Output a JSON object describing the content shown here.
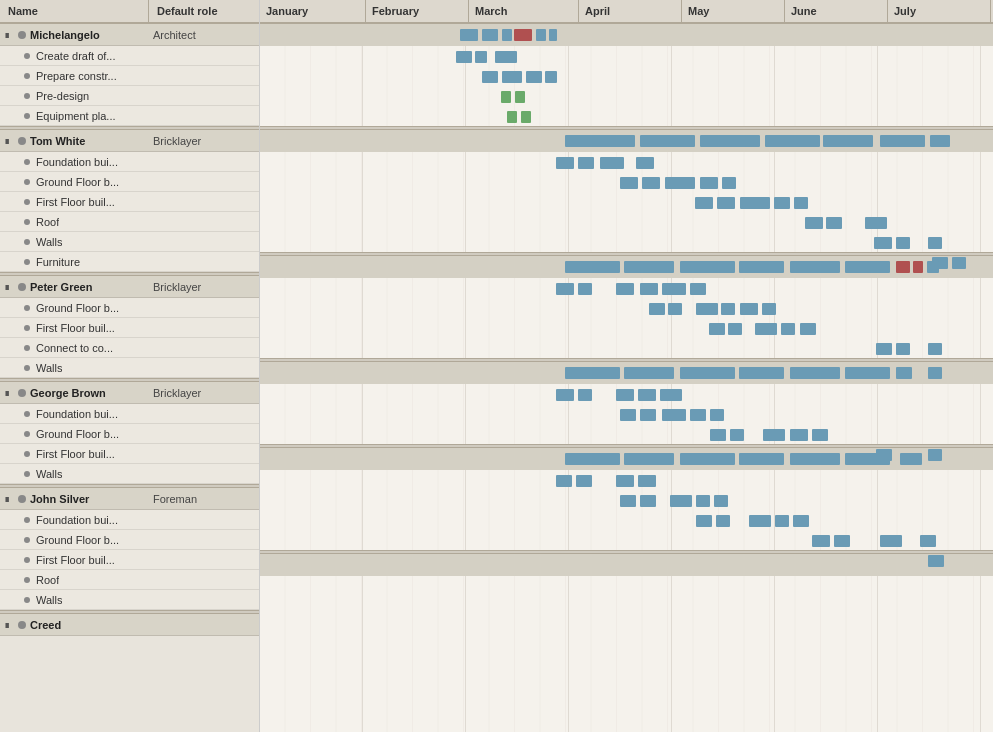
{
  "header": {
    "name_col": "Name",
    "role_col": "Default role"
  },
  "months": [
    {
      "label": "January",
      "width": 80
    },
    {
      "label": "February",
      "width": 80
    },
    {
      "label": "March",
      "width": 80
    },
    {
      "label": "April",
      "width": 80
    },
    {
      "label": "May",
      "width": 80
    },
    {
      "label": "June",
      "width": 80
    },
    {
      "label": "July",
      "width": 80
    }
  ],
  "persons": [
    {
      "name": "Michelangelo",
      "role": "Architect",
      "tasks": [
        {
          "name": "Create draft of..."
        },
        {
          "name": "Prepare constr..."
        },
        {
          "name": "Pre-design"
        },
        {
          "name": "Equipment pla..."
        }
      ]
    },
    {
      "name": "Tom White",
      "role": "Bricklayer",
      "tasks": [
        {
          "name": "Foundation bui..."
        },
        {
          "name": "Ground Floor b..."
        },
        {
          "name": "First Floor buil..."
        },
        {
          "name": "Roof"
        },
        {
          "name": "Walls"
        },
        {
          "name": "Furniture"
        }
      ]
    },
    {
      "name": "Peter Green",
      "role": "Bricklayer",
      "tasks": [
        {
          "name": "Ground Floor b..."
        },
        {
          "name": "First Floor buil..."
        },
        {
          "name": "Connect to co..."
        },
        {
          "name": "Walls"
        }
      ]
    },
    {
      "name": "George Brown",
      "role": "Bricklayer",
      "tasks": [
        {
          "name": "Foundation bui..."
        },
        {
          "name": "Ground Floor b..."
        },
        {
          "name": "First Floor buil..."
        },
        {
          "name": "Walls"
        }
      ]
    },
    {
      "name": "John Silver",
      "role": "Foreman",
      "tasks": [
        {
          "name": "Foundation bui..."
        },
        {
          "name": "Ground Floor b..."
        },
        {
          "name": "First Floor buil..."
        },
        {
          "name": "Roof"
        },
        {
          "name": "Walls"
        }
      ]
    },
    {
      "name": "Creed",
      "role": "",
      "tasks": []
    }
  ]
}
